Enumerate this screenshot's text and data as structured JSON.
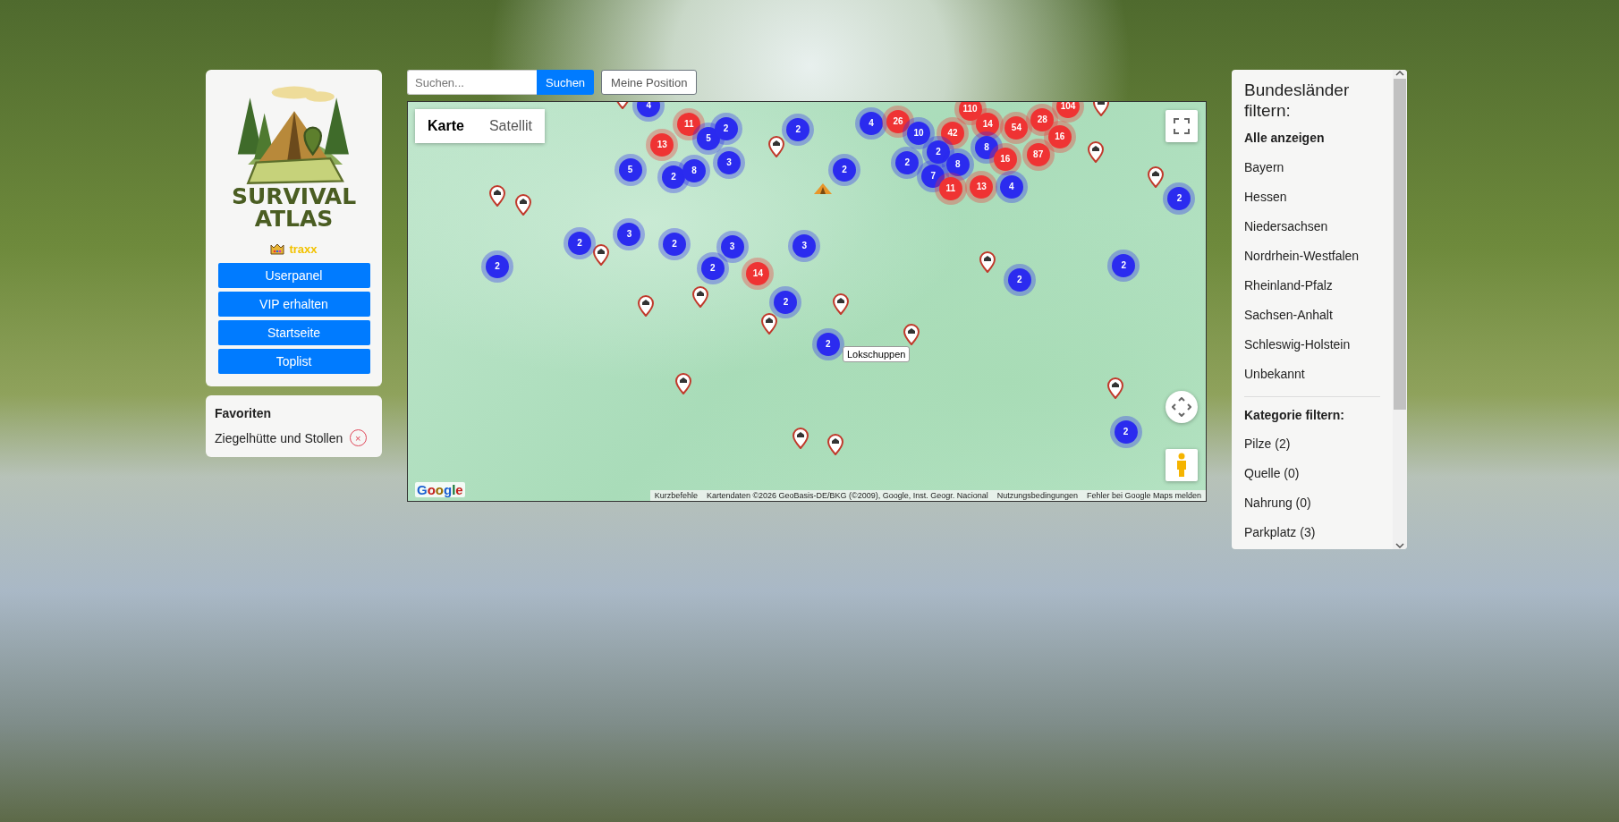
{
  "sidebar": {
    "logo": {
      "lines": [
        "SURVIVAL",
        "ATLAS"
      ]
    },
    "user": {
      "name": "traxx"
    },
    "buttons": [
      {
        "label": "Userpanel"
      },
      {
        "label": "VIP erhalten"
      },
      {
        "label": "Startseite"
      },
      {
        "label": "Toplist"
      }
    ],
    "favorites": {
      "title": "Favoriten",
      "items": [
        {
          "label": "Ziegelhütte und Stollen",
          "remove": "×"
        }
      ]
    }
  },
  "search": {
    "placeholder": "Suchen...",
    "submit": "Suchen",
    "locate": "Meine Position"
  },
  "map": {
    "map_types": [
      {
        "label": "Karte",
        "selected": true
      },
      {
        "label": "Satellit",
        "selected": false
      }
    ],
    "clusters": [
      {
        "count": "4",
        "color": "#2b2bef"
      },
      {
        "count": "11",
        "color": "#ef3333"
      },
      {
        "count": "13",
        "color": "#ef3333"
      },
      {
        "count": "5",
        "color": "#2b2bef"
      },
      {
        "count": "2",
        "color": "#2b2bef"
      },
      {
        "count": "5",
        "color": "#2b2bef"
      },
      {
        "count": "2",
        "color": "#2b2bef"
      },
      {
        "count": "8",
        "color": "#2b2bef"
      },
      {
        "count": "3",
        "color": "#2b2bef"
      },
      {
        "count": "2",
        "color": "#2b2bef"
      },
      {
        "count": "2",
        "color": "#2b2bef"
      },
      {
        "count": "4",
        "color": "#2b2bef"
      },
      {
        "count": "26",
        "color": "#ef3333"
      },
      {
        "count": "10",
        "color": "#2b2bef"
      },
      {
        "count": "42",
        "color": "#ef3333"
      },
      {
        "count": "110",
        "color": "#ef3333"
      },
      {
        "count": "14",
        "color": "#ef3333"
      },
      {
        "count": "54",
        "color": "#ef3333"
      },
      {
        "count": "28",
        "color": "#ef3333"
      },
      {
        "count": "104",
        "color": "#ef3333"
      },
      {
        "count": "2",
        "color": "#2b2bef"
      },
      {
        "count": "2",
        "color": "#2b2bef"
      },
      {
        "count": "8",
        "color": "#2b2bef"
      },
      {
        "count": "7",
        "color": "#2b2bef"
      },
      {
        "count": "8",
        "color": "#2b2bef"
      },
      {
        "count": "16",
        "color": "#ef3333"
      },
      {
        "count": "87",
        "color": "#ef3333"
      },
      {
        "count": "16",
        "color": "#ef3333"
      },
      {
        "count": "11",
        "color": "#ef3333"
      },
      {
        "count": "13",
        "color": "#ef3333"
      },
      {
        "count": "4",
        "color": "#2b2bef"
      },
      {
        "count": "2",
        "color": "#2b2bef"
      },
      {
        "count": "3",
        "color": "#2b2bef"
      },
      {
        "count": "2",
        "color": "#2b2bef"
      },
      {
        "count": "3",
        "color": "#2b2bef"
      },
      {
        "count": "2",
        "color": "#2b2bef"
      },
      {
        "count": "14",
        "color": "#ef3333"
      },
      {
        "count": "3",
        "color": "#2b2bef"
      },
      {
        "count": "2",
        "color": "#2b2bef"
      },
      {
        "count": "2",
        "color": "#2b2bef"
      },
      {
        "count": "2",
        "color": "#2b2bef"
      },
      {
        "count": "2",
        "color": "#2b2bef"
      },
      {
        "count": "2",
        "color": "#2b2bef"
      },
      {
        "count": "2",
        "color": "#2b2bef"
      },
      {
        "count": "2",
        "color": "#2b2bef"
      }
    ],
    "tooltip": "Lokschuppen",
    "google": "Google",
    "attribution": [
      "Kurzbefehle",
      "Kartendaten ©2026 GeoBasis-DE/BKG (©2009), Google, Inst. Geogr. Nacional",
      "Nutzungsbedingungen",
      "Fehler bei Google Maps melden"
    ]
  },
  "filters": {
    "title": "Bundesländer filtern:",
    "items": [
      {
        "label": "Alle anzeigen",
        "kind": "all"
      },
      {
        "label": "Bayern",
        "kind": "state"
      },
      {
        "label": "Hessen",
        "kind": "state"
      },
      {
        "label": "Niedersachsen",
        "kind": "state"
      },
      {
        "label": "Nordrhein-Westfalen",
        "kind": "state"
      },
      {
        "label": "Rheinland-Pfalz",
        "kind": "state"
      },
      {
        "label": "Sachsen-Anhalt",
        "kind": "state"
      },
      {
        "label": "Schleswig-Holstein",
        "kind": "state"
      },
      {
        "label": "Unbekannt",
        "kind": "state"
      }
    ],
    "category_title": "Kategorie filtern:",
    "categories": [
      {
        "label": "Pilze (2)"
      },
      {
        "label": "Quelle (0)"
      },
      {
        "label": "Nahrung (0)"
      },
      {
        "label": "Parkplatz (3)"
      }
    ]
  }
}
